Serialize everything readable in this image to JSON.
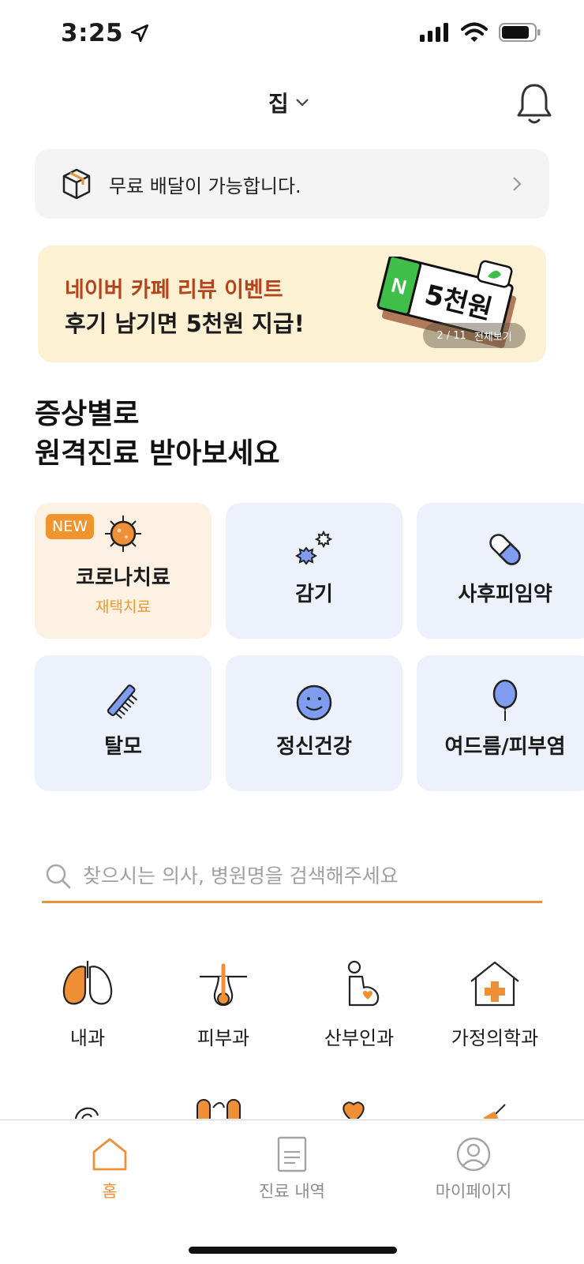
{
  "status_bar": {
    "time": "3:25"
  },
  "header": {
    "location": "집"
  },
  "delivery_banner": {
    "text": "무료 배달이 가능합니다."
  },
  "event_banner": {
    "title": "네이버 카페 리뷰 이벤트",
    "subtitle": "후기 남기면 5천원 지급!",
    "art_badge_letter": "N",
    "art_amount": "5천원",
    "pager": "2 / 11",
    "view_all": "전체보기"
  },
  "section_title": {
    "line1": "증상별로",
    "line2": "원격진료 받아보세요"
  },
  "symptoms": [
    {
      "label": "코로나치료",
      "sub": "재택치료",
      "badge": "NEW",
      "icon": "virus-icon"
    },
    {
      "label": "감기",
      "icon": "germ-icon"
    },
    {
      "label": "사후피임약",
      "icon": "pill-icon"
    },
    {
      "label": "탈모",
      "icon": "comb-icon"
    },
    {
      "label": "정신건강",
      "icon": "smile-face-icon"
    },
    {
      "label": "여드름/피부염",
      "icon": "balloon-icon"
    }
  ],
  "search": {
    "placeholder": "찾으시는 의사, 병원명을 검색해주세요"
  },
  "departments": [
    {
      "label": "내과",
      "icon": "lungs-icon"
    },
    {
      "label": "피부과",
      "icon": "hair-follicle-icon"
    },
    {
      "label": "산부인과",
      "icon": "pregnant-icon"
    },
    {
      "label": "가정의학과",
      "icon": "house-cross-icon"
    }
  ],
  "bottom_nav": [
    {
      "label": "홈",
      "icon": "home-icon",
      "active": true
    },
    {
      "label": "진료 내역",
      "icon": "document-icon",
      "active": false
    },
    {
      "label": "마이페이지",
      "icon": "user-circle-icon",
      "active": false
    }
  ],
  "colors": {
    "accent": "#ea913a",
    "event_red": "#b5441c",
    "card_blue": "#edf1fc",
    "card_orange": "#fdf1e3"
  }
}
